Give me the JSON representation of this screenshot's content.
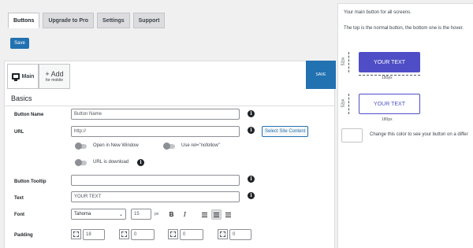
{
  "tabs": [
    {
      "label": "Buttons",
      "active": true
    },
    {
      "label": "Upgrade to Pro",
      "active": false
    },
    {
      "label": "Settings",
      "active": false
    },
    {
      "label": "Support",
      "active": false
    }
  ],
  "save_top_label": "Save",
  "editor": {
    "device_tabs": {
      "main_label": "Main",
      "add_label": "+ Add",
      "add_sub_label": "for mobile"
    },
    "save_label": "SAVE",
    "section_title": "Basics",
    "fields": {
      "button_name": {
        "label": "Button Name",
        "value": "Button Name"
      },
      "url": {
        "label": "URL",
        "value": "http://",
        "select_button": "Select Site Content"
      },
      "toggles": {
        "new_window": "Open in New Window",
        "nofollow": "Use rel=\"nofollow\"",
        "download": "URL is download"
      },
      "tooltip": {
        "label": "Button Tooltip",
        "value": ""
      },
      "text": {
        "label": "Text",
        "value": "YOUR TEXT"
      },
      "font": {
        "label": "Font",
        "family": "Tahoma",
        "size": "15",
        "unit": "px",
        "bold": "B",
        "italic": "I"
      },
      "padding": {
        "label": "Padding",
        "values": [
          "18",
          "0",
          "0",
          "0"
        ]
      }
    }
  },
  "preview": {
    "intro": "Your main button for all screens.",
    "explain": "The top is the normal button, the bottom one is the hover.",
    "normal_button": "YOUR TEXT",
    "hover_button": "YOUR TEXT",
    "height_label_top": "52px",
    "width_label_top": "180px",
    "height_label_bottom": "52px",
    "width_label_bottom": "180px",
    "color_hint": "Change this color to see your button on a differ"
  },
  "colors": {
    "accent": "#2271b1",
    "button_fill": "#4f4ec7"
  }
}
